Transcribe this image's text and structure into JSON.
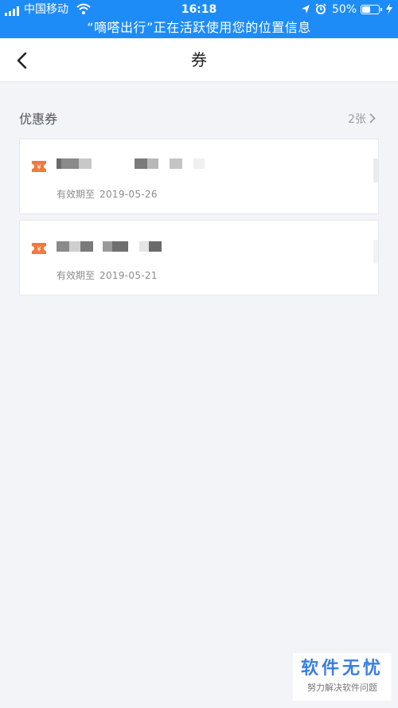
{
  "status_bar": {
    "carrier": "中国移动",
    "time": "16:18",
    "battery_percent": "50%",
    "battery_level": 0.5,
    "icons": [
      "signal-icon",
      "wifi-icon",
      "location-arrow-icon",
      "alarm-icon",
      "battery-icon",
      "charging-icon"
    ],
    "color": "#1e8cf7"
  },
  "location_banner": "“嘀嗒出行”正在活跃使用您的位置信息",
  "nav": {
    "title": "券",
    "back_icon": "chevron-left-icon"
  },
  "section": {
    "title": "优惠券",
    "count": "2张",
    "count_icon": "chevron-right-icon"
  },
  "coupons": [
    {
      "icon": "coupon-ticket-icon",
      "validity_label": "有效期至",
      "validity_date": "2019-05-26"
    },
    {
      "icon": "coupon-ticket-icon",
      "validity_label": "有效期至",
      "validity_date": "2019-05-21"
    }
  ],
  "colors": {
    "accent": "#1e8cf7",
    "coupon_icon": "#f07a3c",
    "background": "#f3f4f8"
  },
  "watermark": {
    "main": "软件无忧",
    "sub": "努力解决软件问题"
  }
}
